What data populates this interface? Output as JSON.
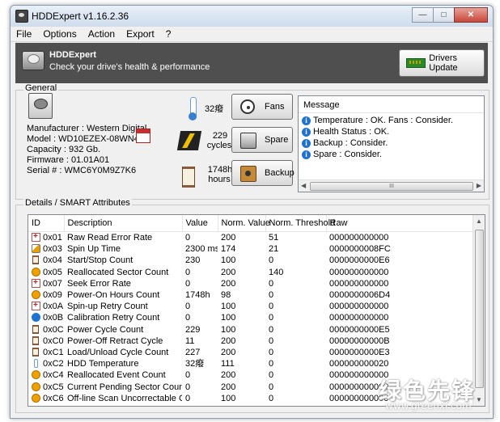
{
  "window": {
    "title": "HDDExpert v1.16.2.36"
  },
  "window_controls": {
    "minimize": "—",
    "maximize": "□",
    "close": "✕"
  },
  "menu": [
    "File",
    "Options",
    "Action",
    "Export",
    "?"
  ],
  "header": {
    "title": "HDDExpert",
    "subtitle": "Check your drive's health & performance",
    "drivers_button": "Drivers Update"
  },
  "general": {
    "label": "General",
    "manufacturer": "Manufacturer : Western Digital",
    "model": "Model : WD10EZEX-08WN4A0",
    "capacity": "Capacity : 932 Gb.",
    "firmware": "Firmware : 01.01A01",
    "serial": "Serial # : WMC6Y0M9Z7K6",
    "temperature": "32癈",
    "cycles_value": "229",
    "cycles_unit": "cycles",
    "hours_value": "1748h",
    "hours_unit": "hours",
    "buttons": {
      "fans": "Fans",
      "spare": "Spare",
      "backup": "Backup"
    }
  },
  "messages": {
    "header": "Message",
    "items": [
      "Temperature : OK. Fans : Consider.",
      "Health Status : OK.",
      "Backup : Consider.",
      "Spare : Consider."
    ],
    "scroll_thumb": "III",
    "scroll_left": "◀",
    "scroll_right": "▶"
  },
  "details": {
    "label": "Details / SMART Attributes",
    "columns": [
      "ID",
      "Description",
      "Value",
      "Norm. Value",
      "Norm. Threshold",
      "Raw"
    ],
    "rows": [
      {
        "icon": "plus",
        "id": "0x01",
        "desc": "Raw Read Error Rate",
        "value": "0",
        "norm": "200",
        "thr": "51",
        "raw": "000000000000"
      },
      {
        "icon": "gauge",
        "id": "0x03",
        "desc": "Spin Up Time",
        "value": "2300 ms",
        "norm": "174",
        "thr": "21",
        "raw": "0000000008FC"
      },
      {
        "icon": "hour",
        "id": "0x04",
        "desc": "Start/Stop Count",
        "value": "230",
        "norm": "100",
        "thr": "0",
        "raw": "0000000000E6"
      },
      {
        "icon": "warn",
        "id": "0x05",
        "desc": "Reallocated Sector Count",
        "value": "0",
        "norm": "200",
        "thr": "140",
        "raw": "000000000000"
      },
      {
        "icon": "plus",
        "id": "0x07",
        "desc": "Seek Error Rate",
        "value": "0",
        "norm": "200",
        "thr": "0",
        "raw": "000000000000"
      },
      {
        "icon": "warn",
        "id": "0x09",
        "desc": "Power-On Hours Count",
        "value": "1748h",
        "norm": "98",
        "thr": "0",
        "raw": "0000000006D4"
      },
      {
        "icon": "plus",
        "id": "0x0A",
        "desc": "Spin-up Retry Count",
        "value": "0",
        "norm": "100",
        "thr": "0",
        "raw": "000000000000"
      },
      {
        "icon": "info",
        "id": "0x0B",
        "desc": "Calibration Retry Count",
        "value": "0",
        "norm": "100",
        "thr": "0",
        "raw": "000000000000"
      },
      {
        "icon": "hour",
        "id": "0x0C",
        "desc": "Power Cycle Count",
        "value": "229",
        "norm": "100",
        "thr": "0",
        "raw": "0000000000E5"
      },
      {
        "icon": "hour",
        "id": "0xC0",
        "desc": "Power-Off Retract Cycle",
        "value": "11",
        "norm": "200",
        "thr": "0",
        "raw": "00000000000B"
      },
      {
        "icon": "hour",
        "id": "0xC1",
        "desc": "Load/Unload Cycle Count",
        "value": "227",
        "norm": "200",
        "thr": "0",
        "raw": "0000000000E3"
      },
      {
        "icon": "temp",
        "id": "0xC2",
        "desc": "HDD Temperature",
        "value": "32癈",
        "norm": "111",
        "thr": "0",
        "raw": "000000000020"
      },
      {
        "icon": "warn",
        "id": "0xC4",
        "desc": "Reallocated Event Count",
        "value": "0",
        "norm": "200",
        "thr": "0",
        "raw": "000000000000"
      },
      {
        "icon": "warn",
        "id": "0xC5",
        "desc": "Current Pending Sector Count",
        "value": "0",
        "norm": "200",
        "thr": "0",
        "raw": "000000000000"
      },
      {
        "icon": "warn",
        "id": "0xC6",
        "desc": "Off-line Scan Uncorrectable Count",
        "value": "0",
        "norm": "100",
        "thr": "0",
        "raw": "000000000000"
      }
    ],
    "scroll_up": "▲",
    "scroll_down": "▼"
  },
  "watermark": {
    "text": "绿色先锋",
    "url": "www.greenxf.com"
  }
}
